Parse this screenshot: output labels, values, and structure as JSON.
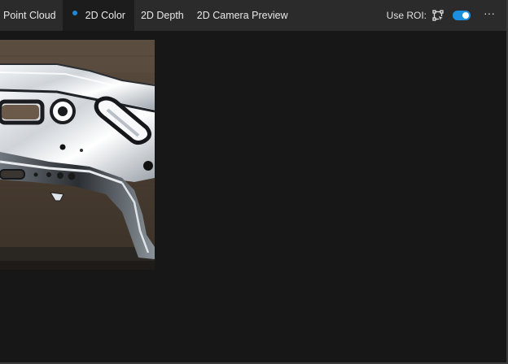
{
  "tabs": [
    {
      "label": "Point Cloud",
      "active": false
    },
    {
      "label": "2D Color",
      "active": true
    },
    {
      "label": "2D Depth",
      "active": false
    },
    {
      "label": "2D Camera Preview",
      "active": false
    }
  ],
  "toolbar": {
    "roi_label": "Use ROI:",
    "roi_icon": "roi-select-icon",
    "roi_enabled": true,
    "more_label": "···"
  },
  "colors": {
    "accent": "#1c8ad6",
    "tabbar": "#2b2b2b",
    "background": "#171717"
  },
  "viewer": {
    "image_subject": "metal-bracket-part"
  }
}
